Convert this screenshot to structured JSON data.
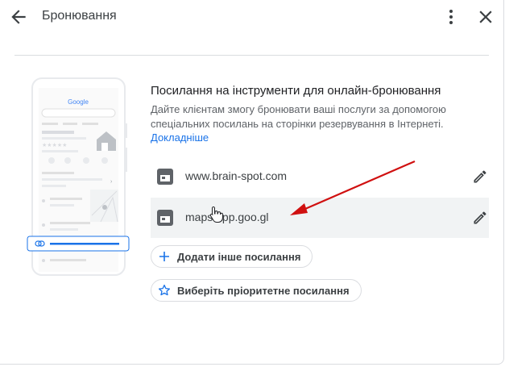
{
  "header": {
    "title": "Бронювання",
    "back_icon": "arrow-back-icon",
    "more_icon": "more-vert-icon",
    "close_icon": "close-icon"
  },
  "illustration": {
    "logo_text": "Google"
  },
  "main": {
    "section_title": "Посилання на інструменти для онлайн-бронювання",
    "description": "Дайте клієнтам змогу бронювати ваші послуги за допомогою спеціальних посилань на сторінки резервування в Інтернеті.",
    "learn_more": "Докладніше",
    "links": [
      {
        "url": "www.brain-spot.com",
        "icon": "calendar-icon",
        "edit_icon": "pencil-icon"
      },
      {
        "url": "maps.app.goo.gl",
        "icon": "calendar-icon",
        "edit_icon": "pencil-icon"
      }
    ],
    "add_link_label": "Додати інше посилання",
    "priority_link_label": "Виберіть пріоритетне посилання"
  },
  "colors": {
    "accent": "#1a73e8",
    "annotation_arrow": "#d01010",
    "text_secondary": "#5f6368"
  }
}
